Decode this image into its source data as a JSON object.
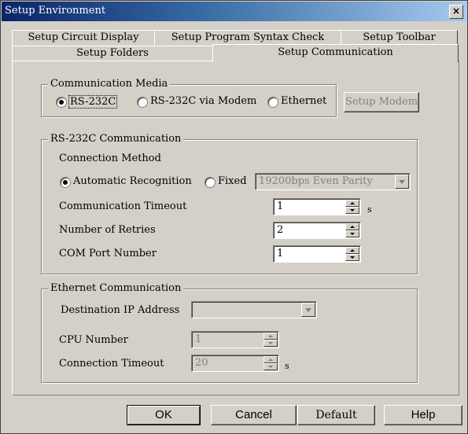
{
  "window": {
    "title": "Setup Environment",
    "close": "×"
  },
  "tabs": {
    "row1": [
      "Setup Circuit Display",
      "Setup Program Syntax Check",
      "Setup Toolbar"
    ],
    "row2": [
      "Setup Folders",
      "Setup Communication"
    ]
  },
  "media": {
    "label": "Communication Media",
    "options": [
      "RS-232C",
      "RS-232C via Modem",
      "Ethernet"
    ],
    "selected": "RS-232C",
    "setup_modem": "Setup Modem"
  },
  "rs232c": {
    "label": "RS-232C Communication",
    "connection_method": "Connection Method",
    "auto": "Automatic Recognition",
    "fixed": "Fixed",
    "selected": "Automatic Recognition",
    "baud_value": "19200bps Even Parity",
    "timeout_label": "Communication Timeout",
    "timeout_value": "1",
    "timeout_unit": "s",
    "retries_label": "Number of Retries",
    "retries_value": "2",
    "com_label": "COM Port Number",
    "com_value": "1"
  },
  "ethernet": {
    "label": "Ethernet Communication",
    "ip_label": "Destination IP Address",
    "ip_value": "",
    "cpu_label": "CPU Number",
    "cpu_value": "1",
    "timeout_label": "Connection Timeout",
    "timeout_value": "20",
    "timeout_unit": "s"
  },
  "buttons": {
    "ok": "OK",
    "cancel": "Cancel",
    "default": "Default",
    "help": "Help"
  }
}
